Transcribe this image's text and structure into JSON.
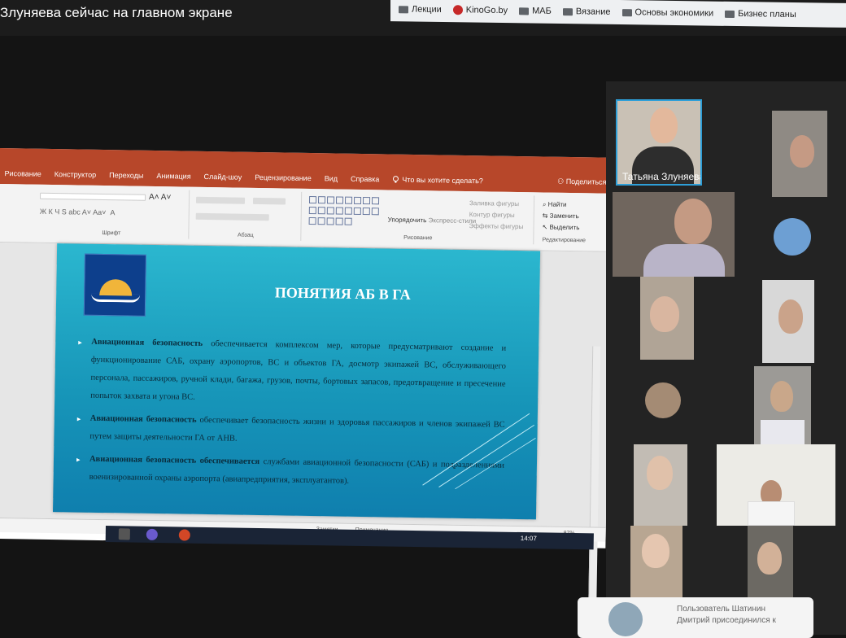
{
  "meeting": {
    "banner_title": "Злуняева сейчас на главном экране"
  },
  "bookmarks": [
    {
      "label": "Лекции",
      "icon": "folder-icon"
    },
    {
      "label": "KinoGo.by",
      "icon": "kinogo-icon"
    },
    {
      "label": "МАБ",
      "icon": "folder-icon"
    },
    {
      "label": "Вязание",
      "icon": "folder-icon"
    },
    {
      "label": "Основы экономики",
      "icon": "folder-icon"
    },
    {
      "label": "Бизнес планы",
      "icon": "folder-icon"
    }
  ],
  "ribbon": {
    "tabs": [
      "Рисование",
      "Конструктор",
      "Переходы",
      "Анимация",
      "Слайд-шоу",
      "Рецензирование",
      "Вид",
      "Справка"
    ],
    "search_placeholder": "Что вы хотите сделать?",
    "share_label": "Поделиться",
    "groups": {
      "font": "Шрифт",
      "paragraph": "Абзац",
      "drawing": "Рисование",
      "editing": "Редактирование"
    },
    "commands": {
      "arrange": "Упорядочить",
      "express_styles": "Экспресс-стили",
      "shape_fill": "Заливка фигуры",
      "shape_outline": "Контур фигуры",
      "shape_effects": "Эффекты фигуры",
      "find": "Найти",
      "replace": "Заменить",
      "select": "Выделить"
    }
  },
  "slide": {
    "title": "ПОНЯТИЯ АБ В ГА",
    "bullets": [
      {
        "bold": "Авиационная безопасность",
        "text": " обеспечивается комплексом мер, которые предусматривают создание и функционирование САБ, охрану аэропортов, ВС и объектов ГА, досмотр экипажей ВС, обслуживающего персонала, пассажиров, ручной клади, багажа, грузов, почты, бортовых запасов, предотвращение и пресечение попыток захвата и угона ВС."
      },
      {
        "bold": "Авиационная безопасность",
        "text": " обеспечивает безопасность жизни и здоровья пассажиров и членов экипажей ВС путем защиты деятельности ГА от АНВ."
      },
      {
        "bold": "Авиационная безопасность обеспечивается",
        "text": " службами авиационной безопасности (САБ) и подразделениями военизированной охраны аэропорта (авиапредприятия, эксплуатантов)."
      }
    ]
  },
  "status_bar": {
    "notes": "Заметки",
    "comments": "Примечания",
    "zoom": "87%"
  },
  "taskbar": {
    "time": "14:07"
  },
  "participants": [
    {
      "name": "Татьяна Злуняева",
      "active": true
    }
  ],
  "notification": {
    "line1": "Пользователь Шатинин",
    "line2": "Дмитрий присоединился к"
  },
  "colors": {
    "ppt_accent": "#b7472a",
    "slide_top": "#2bb7cf",
    "slide_bottom": "#0f7fae",
    "active_speaker": "#2e9fd8"
  }
}
